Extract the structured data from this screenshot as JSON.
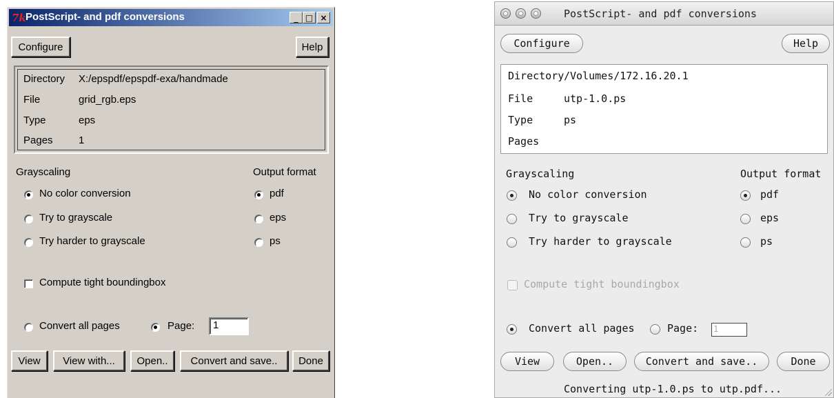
{
  "windows_app": {
    "title": "PostScript- and pdf conversions",
    "tk_logo": "7k",
    "controls": {
      "minimize": "_",
      "maximize": "□",
      "close": "×"
    },
    "configure_label": "Configure",
    "help_label": "Help",
    "info": {
      "directory_label": "Directory",
      "directory_value": "X:/epspdf/epspdf-exa/handmade",
      "file_label": "File",
      "file_value": "grid_rgb.eps",
      "type_label": "Type",
      "type_value": "eps",
      "pages_label": "Pages",
      "pages_value": "1"
    },
    "grayscaling_label": "Grayscaling",
    "gray_options": [
      "No color conversion",
      "Try to grayscale",
      "Try harder to grayscale"
    ],
    "gray_selected": 0,
    "output_format_label": "Output format",
    "format_options": [
      "pdf",
      "eps",
      "ps"
    ],
    "format_selected": 0,
    "bbox_label": "Compute tight boundingbox",
    "bbox_checked": false,
    "convert_all_label": "Convert all pages",
    "page_label": "Page:",
    "page_value": "1",
    "pages_mode_selected": "page",
    "buttons": {
      "view": "View",
      "view_with": "View with...",
      "open": "Open..",
      "convert": "Convert and save..",
      "done": "Done"
    }
  },
  "mac_app": {
    "title": "PostScript- and pdf conversions",
    "configure_label": "Configure",
    "help_label": "Help",
    "info": {
      "directory_label": "Directory",
      "directory_value": "/Volumes/172.16.20.1",
      "file_label": "File",
      "file_value": "utp-1.0.ps",
      "type_label": "Type",
      "type_value": "ps",
      "pages_label": "Pages",
      "pages_value": ""
    },
    "grayscaling_label": "Grayscaling",
    "gray_options": [
      "No color conversion",
      "Try to grayscale",
      "Try harder to grayscale"
    ],
    "gray_selected": 0,
    "output_format_label": "Output format",
    "format_options": [
      "pdf",
      "eps",
      "ps"
    ],
    "format_selected": 0,
    "bbox_label": "Compute tight boundingbox",
    "bbox_disabled": true,
    "convert_all_label": "Convert all pages",
    "page_label": "Page:",
    "page_value": "1",
    "pages_mode_selected": "all",
    "buttons": {
      "view": "View",
      "open": "Open..",
      "convert": "Convert and save..",
      "done": "Done"
    },
    "status": "Converting utp-1.0.ps to utp.pdf..."
  }
}
